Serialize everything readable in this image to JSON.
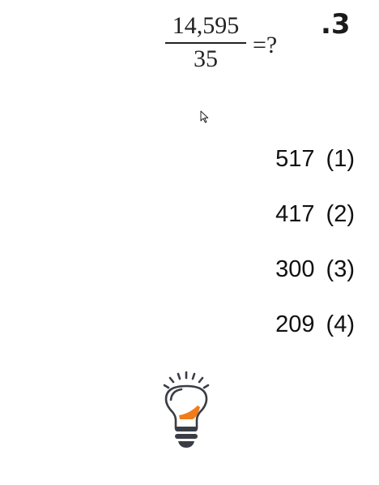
{
  "question": {
    "number": ".3",
    "numerator": "14,595",
    "denominator": "35",
    "suffix": "=?"
  },
  "options": [
    {
      "value": "517",
      "label": "(1)"
    },
    {
      "value": "417",
      "label": "(2)"
    },
    {
      "value": "300",
      "label": "(3)"
    },
    {
      "value": "209",
      "label": "(4)"
    }
  ],
  "icons": {
    "cursor": "mouse-pointer-icon",
    "hint": "lightbulb-icon"
  },
  "colors": {
    "text": "#111111",
    "bulb_outline": "#3a3d45",
    "bulb_accent": "#f07d1a"
  }
}
